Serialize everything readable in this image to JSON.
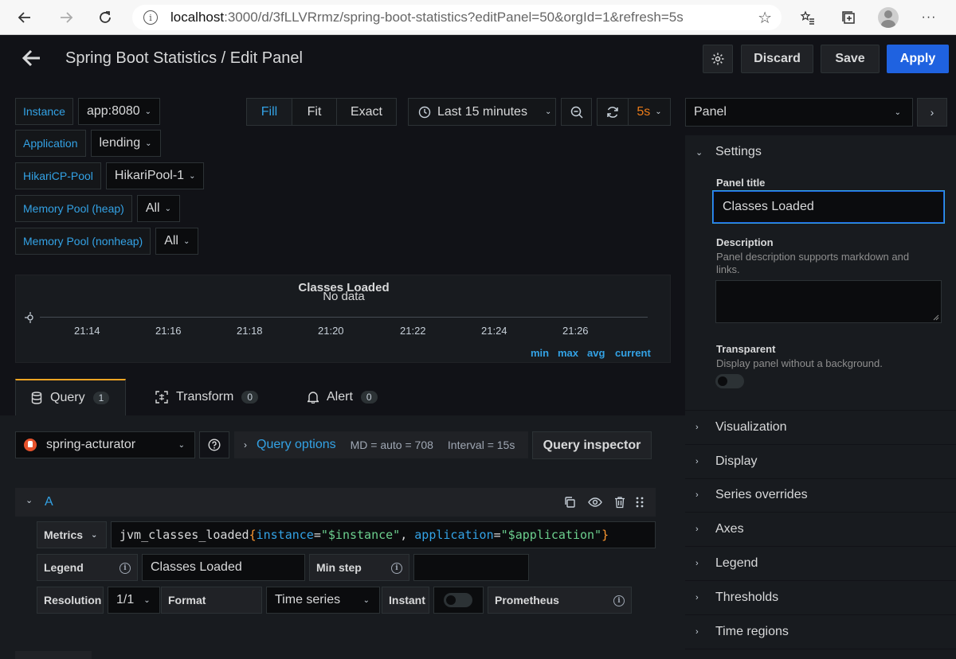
{
  "browser": {
    "url_host": "localhost",
    "url_path": ":3000/d/3fLLVRrmz/spring-boot-statistics?editPanel=50&orgId=1&refresh=5s"
  },
  "header": {
    "title": "Spring Boot Statistics / Edit Panel",
    "discard_label": "Discard",
    "save_label": "Save",
    "apply_label": "Apply"
  },
  "variables": [
    {
      "label": "Instance",
      "value": "app:8080"
    },
    {
      "label": "Application",
      "value": "lending"
    },
    {
      "label": "HikariCP-Pool",
      "value": "HikariPool-1"
    },
    {
      "label": "Memory Pool (heap)",
      "value": "All"
    },
    {
      "label": "Memory Pool (nonheap)",
      "value": "All"
    }
  ],
  "toolbar": {
    "fill": "Fill",
    "fit": "Fit",
    "exact": "Exact",
    "time_range": "Last 15 minutes",
    "refresh_interval": "5s"
  },
  "preview": {
    "title": "Classes Loaded",
    "no_data": "No data",
    "ticks": [
      "21:14",
      "21:16",
      "21:18",
      "21:20",
      "21:22",
      "21:24",
      "21:26"
    ],
    "legend_columns": [
      "min",
      "max",
      "avg",
      "current"
    ]
  },
  "tabs": {
    "query": {
      "label": "Query",
      "count": "1"
    },
    "transform": {
      "label": "Transform",
      "count": "0"
    },
    "alert": {
      "label": "Alert",
      "count": "0"
    }
  },
  "query": {
    "datasource": "spring-acturator",
    "options_label": "Query options",
    "md": "MD = auto = 708",
    "interval": "Interval = 15s",
    "inspector_label": "Query inspector",
    "ref_id": "A",
    "metrics_label": "Metrics",
    "expr_metric": "jvm_classes_loaded",
    "expr_open": "{",
    "expr_k1": "instance",
    "expr_eq": "=",
    "expr_v1": "\"$instance\"",
    "expr_sep": ", ",
    "expr_k2": "application",
    "expr_v2": "\"$application\"",
    "expr_close": "}",
    "legend_label": "Legend",
    "legend_value": "Classes Loaded",
    "min_step_label": "Min step",
    "min_step_value": "",
    "resolution_label": "Resolution",
    "resolution_value": "1/1",
    "format_label": "Format",
    "format_value": "Time series",
    "instant_label": "Instant",
    "prometheus_label": "Prometheus"
  },
  "sidebar": {
    "panel_select": "Panel",
    "settings": "Settings",
    "panel_title_label": "Panel title",
    "panel_title_value": "Classes Loaded",
    "description_label": "Description",
    "description_help": "Panel description supports markdown and links.",
    "transparent_label": "Transparent",
    "transparent_help": "Display panel without a background.",
    "sections": [
      "Visualization",
      "Display",
      "Series overrides",
      "Axes",
      "Legend",
      "Thresholds",
      "Time regions"
    ]
  },
  "colors": {
    "accent_blue": "#33a2e5",
    "apply_blue": "#1f62e0",
    "tab_active": "#f5a523",
    "refresh_orange": "#eb7b18",
    "string_green": "#6ccf8e",
    "key_blue": "#33a2e5",
    "brace_orange": "#ff9830"
  }
}
